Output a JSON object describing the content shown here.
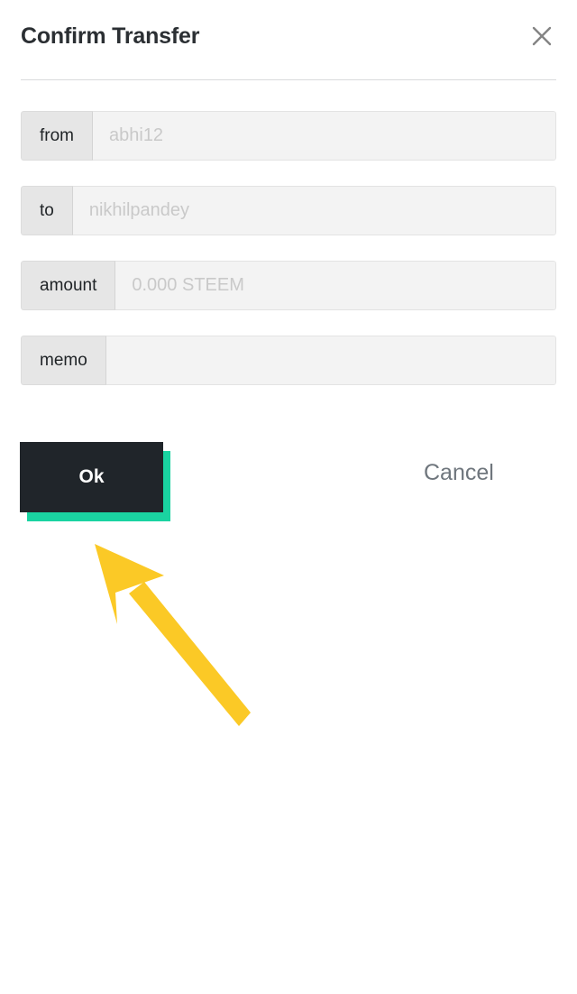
{
  "dialog": {
    "title": "Confirm Transfer",
    "close_icon": "close-icon"
  },
  "fields": [
    {
      "label": "from",
      "value": "",
      "placeholder": "abhi12"
    },
    {
      "label": "to",
      "value": "",
      "placeholder": "nikhilpandey"
    },
    {
      "label": "amount",
      "value": "",
      "placeholder": "0.000 STEEM"
    },
    {
      "label": "memo",
      "value": "",
      "placeholder": ""
    }
  ],
  "actions": {
    "ok_label": "Ok",
    "cancel_label": "Cancel"
  },
  "annotation": {
    "type": "arrow",
    "points_to": "ok-button",
    "color": "#FBC926"
  },
  "colors": {
    "accent_teal": "#1ad3a1",
    "button_dark": "#20252a",
    "field_prefix_bg": "#e6e6e6",
    "field_input_bg": "#f3f3f3",
    "placeholder_text": "#c9c9c9",
    "cancel_text": "#6f767d",
    "title_text": "#2b2f33",
    "arrow_yellow": "#FBC926"
  }
}
